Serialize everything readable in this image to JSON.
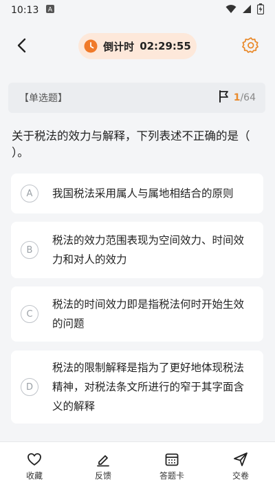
{
  "status_bar": {
    "time": "10:13"
  },
  "header": {
    "timer_label": "倒计时",
    "timer_value": "02:29:55"
  },
  "question_card": {
    "type_label": "【单选题】",
    "current": "1",
    "total": "/64"
  },
  "question": {
    "text": "关于税法的效力与解释，下列表述不正确的是（ ）。"
  },
  "options": [
    {
      "letter": "A",
      "text": "我国税法采用属人与属地相结合的原则"
    },
    {
      "letter": "B",
      "text": "税法的效力范围表现为空间效力、时间效力和对人的效力"
    },
    {
      "letter": "C",
      "text": "税法的时间效力即是指税法何时开始生效的问题"
    },
    {
      "letter": "D",
      "text": "税法的限制解释是指为了更好地体现税法精神，对税法条文所进行的窄于其字面含义的解释"
    }
  ],
  "bottom_nav": [
    {
      "label": "收藏",
      "icon": "heart-icon"
    },
    {
      "label": "反馈",
      "icon": "edit-icon"
    },
    {
      "label": "答题卡",
      "icon": "calendar-icon"
    },
    {
      "label": "交卷",
      "icon": "send-icon"
    }
  ],
  "colors": {
    "accent": "#e98a2c",
    "timer_bg": "#fde8da",
    "timer_icon": "#f07a2a"
  }
}
